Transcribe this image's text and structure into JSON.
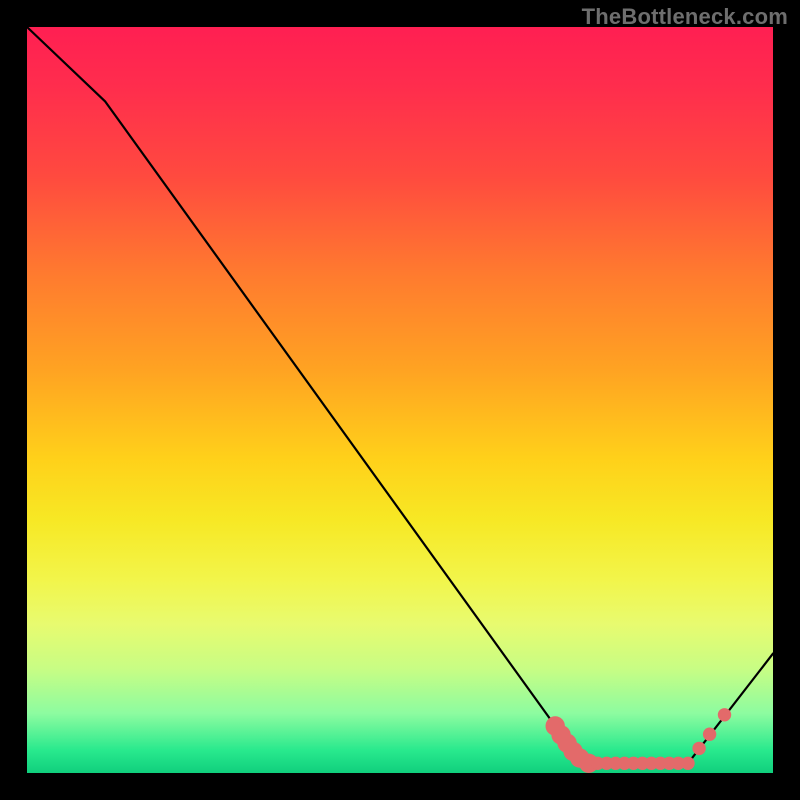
{
  "watermark": "TheBottleneck.com",
  "chart_data": {
    "type": "line",
    "title": "",
    "xlabel": "",
    "ylabel": "",
    "xlim": [
      0,
      100
    ],
    "ylim": [
      0,
      100
    ],
    "series": [
      {
        "name": "bottleneck-curve",
        "x": [
          0.0,
          10.5,
          70.8,
          75.3,
          88.6,
          100.0
        ],
        "values": [
          100.0,
          90.0,
          6.3,
          1.3,
          1.3,
          16.0
        ]
      }
    ],
    "markers": {
      "name": "highlight-cluster",
      "color": "#e36a6a",
      "points": [
        {
          "x": 70.8,
          "y": 6.3,
          "r": 1.3
        },
        {
          "x": 71.6,
          "y": 5.1,
          "r": 1.3
        },
        {
          "x": 72.4,
          "y": 4.0,
          "r": 1.3
        },
        {
          "x": 73.2,
          "y": 2.9,
          "r": 1.3
        },
        {
          "x": 74.1,
          "y": 2.0,
          "r": 1.3
        },
        {
          "x": 75.3,
          "y": 1.3,
          "r": 1.3
        },
        {
          "x": 76.5,
          "y": 1.3,
          "r": 0.9
        },
        {
          "x": 77.7,
          "y": 1.3,
          "r": 0.9
        },
        {
          "x": 78.9,
          "y": 1.3,
          "r": 0.9
        },
        {
          "x": 80.1,
          "y": 1.3,
          "r": 0.9
        },
        {
          "x": 81.3,
          "y": 1.3,
          "r": 0.9
        },
        {
          "x": 82.5,
          "y": 1.3,
          "r": 0.9
        },
        {
          "x": 83.7,
          "y": 1.3,
          "r": 0.9
        },
        {
          "x": 84.9,
          "y": 1.3,
          "r": 0.9
        },
        {
          "x": 86.1,
          "y": 1.3,
          "r": 0.9
        },
        {
          "x": 87.3,
          "y": 1.3,
          "r": 0.9
        },
        {
          "x": 88.6,
          "y": 1.3,
          "r": 0.9
        },
        {
          "x": 90.1,
          "y": 3.3,
          "r": 0.9
        },
        {
          "x": 91.5,
          "y": 5.2,
          "r": 0.9
        },
        {
          "x": 93.5,
          "y": 7.8,
          "r": 0.9
        }
      ]
    },
    "gradient_stops": [
      {
        "offset": 0.0,
        "color": "#ff1f52"
      },
      {
        "offset": 0.08,
        "color": "#ff2d4d"
      },
      {
        "offset": 0.2,
        "color": "#ff4a3f"
      },
      {
        "offset": 0.33,
        "color": "#ff7a2f"
      },
      {
        "offset": 0.46,
        "color": "#ffa322"
      },
      {
        "offset": 0.58,
        "color": "#ffd11a"
      },
      {
        "offset": 0.66,
        "color": "#f7e824"
      },
      {
        "offset": 0.74,
        "color": "#f2f54a"
      },
      {
        "offset": 0.8,
        "color": "#e8fb6f"
      },
      {
        "offset": 0.86,
        "color": "#c8fd84"
      },
      {
        "offset": 0.92,
        "color": "#8dfca0"
      },
      {
        "offset": 0.97,
        "color": "#28e98d"
      },
      {
        "offset": 1.0,
        "color": "#10cf7d"
      }
    ]
  }
}
